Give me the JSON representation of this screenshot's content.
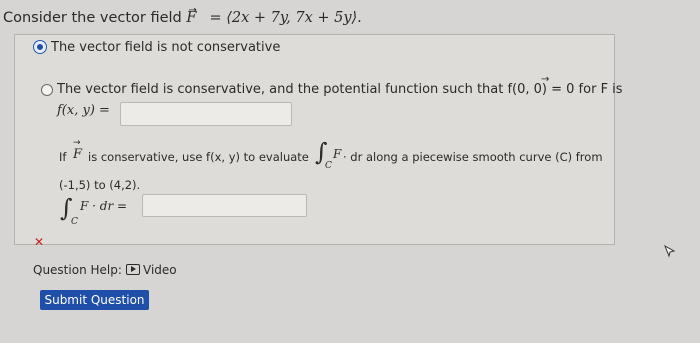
{
  "question": {
    "prompt_text": "Consider the vector field ",
    "field_symbol": "F",
    "field_equals": "=",
    "field_value": "⟨2x + 7y, 7x + 5y⟩."
  },
  "options": {
    "selected_label": "The vector field is not conservative",
    "conservative_label": "The vector field is conservative, and the potential function such that f(0, 0) = 0 for F is",
    "potential_label": "f(x, y) =",
    "potential_value": ""
  },
  "evaluate": {
    "line1_prefix": "If",
    "line1_mid": "is conservative, use f(x, y) to evaluate",
    "line1_suffix": "· dr along a piecewise smooth curve (C) from",
    "line2": "(-1,5) to (4,2).",
    "integral_sub": "C",
    "integral_body": "F · dr =",
    "integral_value": ""
  },
  "status": {
    "incorrect_mark": "✕"
  },
  "help": {
    "label": "Question Help:",
    "video_label": "Video"
  },
  "submit": {
    "label": "Submit Question"
  }
}
